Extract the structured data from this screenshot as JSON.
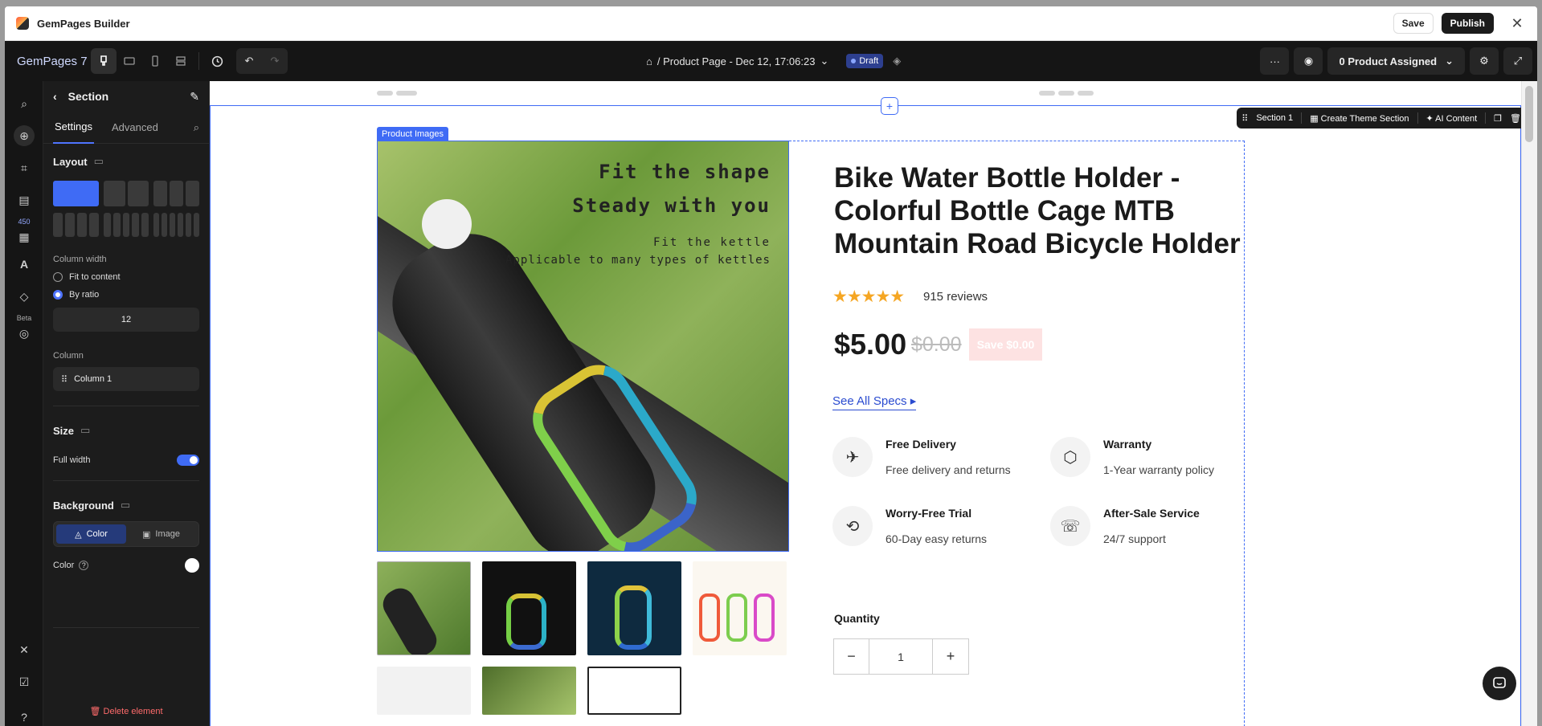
{
  "app": {
    "title": "GemPages Builder",
    "save": "Save",
    "publish": "Publish"
  },
  "topbar": {
    "brand": "GemPages 7",
    "page_title": "/ Product Page - Dec 12, 17:06:23",
    "status": "Draft",
    "assigned": "0 Product Assigned"
  },
  "rail": {
    "count_badge": "450",
    "beta": "Beta"
  },
  "panel": {
    "title": "Section",
    "tabs": [
      "Settings",
      "Advanced"
    ],
    "layout_title": "Layout",
    "column_width_label": "Column width",
    "opt_fit": "Fit to content",
    "opt_ratio": "By ratio",
    "ratio_value": "12",
    "column_label": "Column",
    "column_item": "Column 1",
    "size_title": "Size",
    "full_width": "Full width",
    "background_title": "Background",
    "bg_color": "Color",
    "bg_image": "Image",
    "color_label": "Color",
    "delete": "Delete element"
  },
  "canvas": {
    "section_tools": {
      "section": "Section 1",
      "create_theme": "Create Theme Section",
      "ai_content": "AI Content"
    },
    "image_label": "Product Images",
    "image_text": {
      "line1": "Fit the shape",
      "line2": "Steady with you",
      "line3": "Fit the kettle",
      "line4": "Applicable to many types of kettles"
    },
    "product_title": "Bike Water Bottle Holder - Colorful Bottle Cage MTB Mountain Road Bicycle Holder",
    "stars": "★★★★★",
    "reviews": "915 reviews",
    "price": "$5.00",
    "compare_price": "$0.00",
    "save_badge": "Save $0.00",
    "see_specs": "See All Specs",
    "features": [
      {
        "title": "Free Delivery",
        "desc": "Free delivery and returns"
      },
      {
        "title": "Warranty",
        "desc": "1-Year warranty policy"
      },
      {
        "title": "Worry-Free Trial",
        "desc": "60-Day easy returns"
      },
      {
        "title": "After-Sale Service",
        "desc": "24/7 support"
      }
    ],
    "quantity_label": "Quantity",
    "quantity_value": "1"
  },
  "colors": {
    "accent": "#3f6bf5",
    "dark": "#151515",
    "star": "#f5a623"
  }
}
